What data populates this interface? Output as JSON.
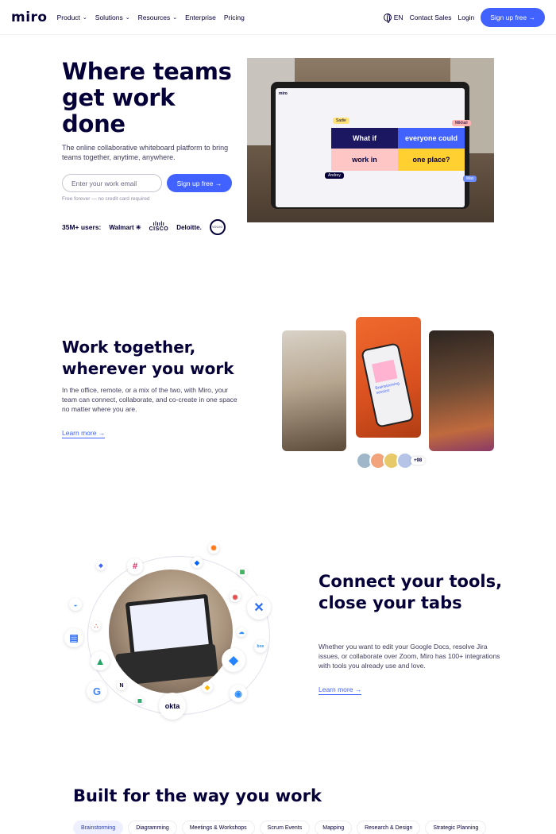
{
  "nav": {
    "logo": "miro",
    "links": [
      {
        "label": "Product",
        "has_chevron": true
      },
      {
        "label": "Solutions",
        "has_chevron": true
      },
      {
        "label": "Resources",
        "has_chevron": true
      },
      {
        "label": "Enterprise",
        "has_chevron": false
      },
      {
        "label": "Pricing",
        "has_chevron": false
      }
    ],
    "language": "EN",
    "contact_sales": "Contact Sales",
    "login": "Login",
    "signup": "Sign up free →"
  },
  "hero": {
    "title": "Where teams get work done",
    "subtitle": "The online collaborative whiteboard platform to bring teams together, anytime, anywhere.",
    "email_placeholder": "Enter your work email",
    "signup": "Sign up free →",
    "note": "Free forever — no credit card required",
    "users_label": "35M+ users:",
    "brands": [
      "Walmart",
      "CISCO",
      "Deloitte.",
      "VOLVO"
    ],
    "board": {
      "app_name": "miro",
      "cells": [
        "What if",
        "everyone could",
        "work in",
        "one place?"
      ],
      "cursors": [
        "Sadie",
        "Mikhail",
        "Andrey",
        "Max"
      ]
    }
  },
  "section2": {
    "title": "Work together, wherever you work",
    "text": "In the office, remote, or a mix of the two, with Miro, your team can connect, collaborate, and co-create in one space no matter where you are.",
    "learn_more": "Learn more →",
    "phone_note": "Brainstorming session",
    "avatar_count": "+98"
  },
  "section3": {
    "title": "Connect your tools, close your tabs",
    "text": "Whether you want to edit your Google Docs, resolve Jira issues, or collaborate over Zoom, Miro has 100+ integrations with tools you already use and love.",
    "learn_more": "Learn more →",
    "integrations": [
      "okta"
    ]
  },
  "section4": {
    "title": "Built for the way you work",
    "tabs": [
      "Brainstorming",
      "Diagramming",
      "Meetings & Workshops",
      "Scrum Events",
      "Mapping",
      "Research & Design",
      "Strategic Planning"
    ],
    "active_tab": "Brainstorming"
  },
  "colors": {
    "primary": "#4262ff",
    "text": "#050038"
  }
}
